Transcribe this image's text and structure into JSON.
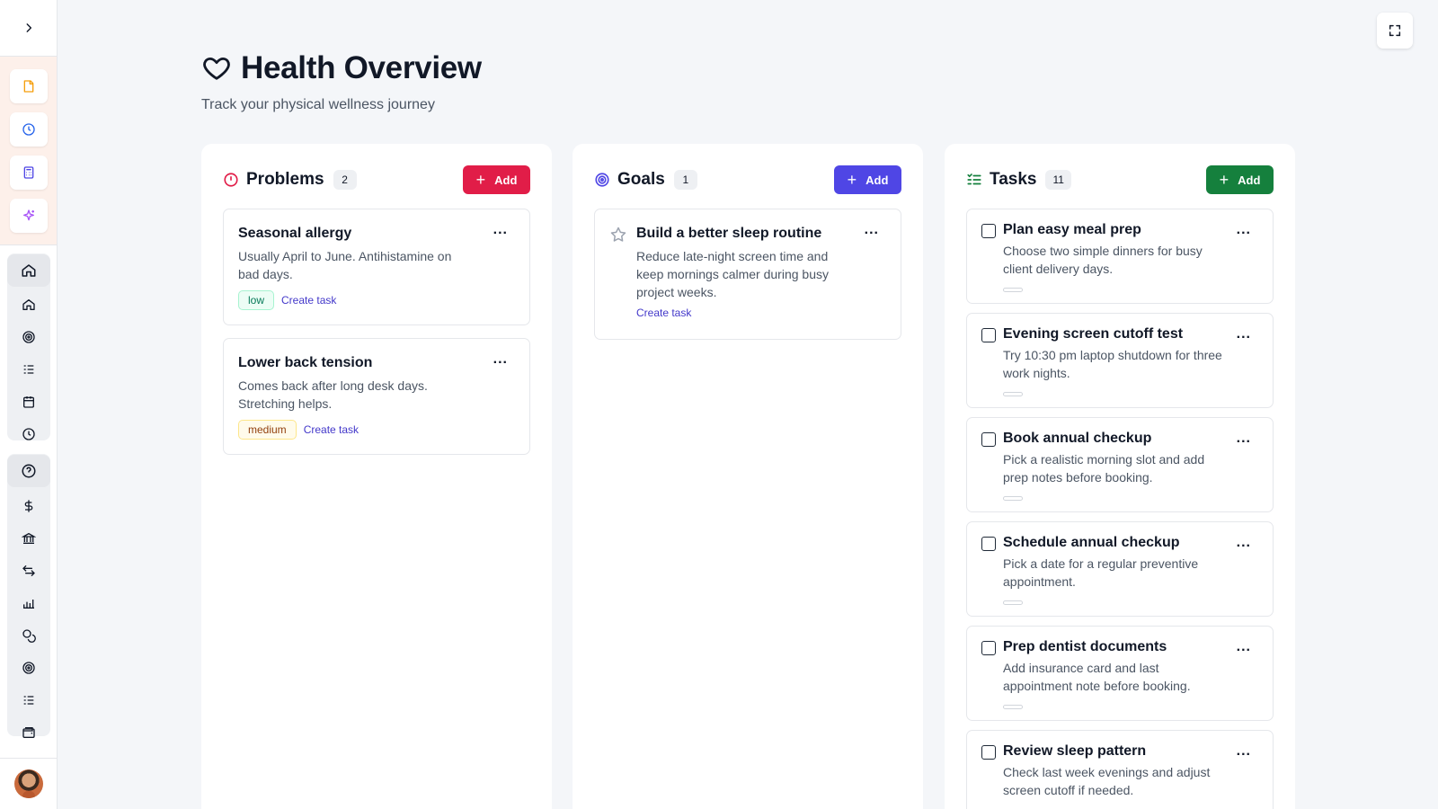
{
  "header": {
    "title": "Health Overview",
    "subtitle": "Track your physical wellness journey"
  },
  "columns": {
    "problems": {
      "title": "Problems",
      "count": "2",
      "add_label": "Add",
      "accent": "#e11d48",
      "items": [
        {
          "title": "Seasonal allergy",
          "desc": "Usually April to June. Antihistamine on bad days.",
          "severity": "low",
          "link": "Create task"
        },
        {
          "title": "Lower back tension",
          "desc": "Comes back after long desk days. Stretching helps.",
          "severity": "medium",
          "link": "Create task"
        }
      ]
    },
    "goals": {
      "title": "Goals",
      "count": "1",
      "add_label": "Add",
      "accent": "#4f46e5",
      "items": [
        {
          "title": "Build a better sleep routine",
          "desc": "Reduce late-night screen time and keep mornings calmer during busy project weeks.",
          "link": "Create task"
        }
      ]
    },
    "tasks": {
      "title": "Tasks",
      "count": "11",
      "add_label": "Add",
      "accent": "#15803d",
      "items": [
        {
          "title": "Plan easy meal prep",
          "desc": "Choose two simple dinners for busy client delivery days."
        },
        {
          "title": "Evening screen cutoff test",
          "desc": "Try 10:30 pm laptop shutdown for three work nights."
        },
        {
          "title": "Book annual checkup",
          "desc": "Pick a realistic morning slot and add prep notes before booking."
        },
        {
          "title": "Schedule annual checkup",
          "desc": "Pick a date for a regular preventive appointment."
        },
        {
          "title": "Prep dentist documents",
          "desc": "Add insurance card and last appointment note before booking."
        },
        {
          "title": "Review sleep pattern",
          "desc": "Check last week evenings and adjust screen cutoff if needed."
        }
      ]
    }
  },
  "menu_label": "...",
  "icons": {
    "sidebar_toggle": "chevron-right-icon",
    "expand": "fullscreen-icon",
    "title": "heart-icon"
  }
}
